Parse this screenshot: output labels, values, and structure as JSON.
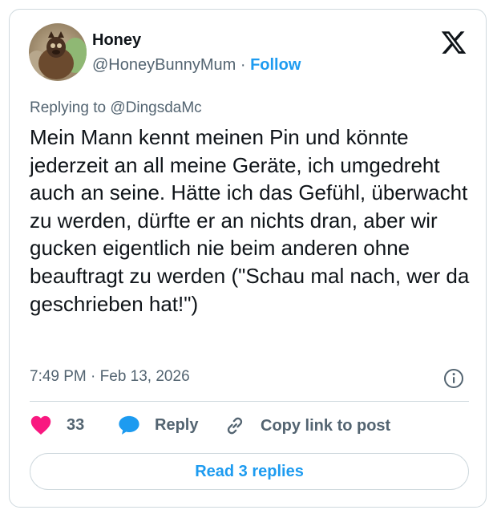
{
  "author": {
    "name": "Honey",
    "handle": "@HoneyBunnyMum",
    "separator": " · ",
    "follow_label": "Follow"
  },
  "reply_context": {
    "prefix": "Replying to ",
    "target": "@DingsdaMc"
  },
  "tweet": {
    "text": "Mein Mann kennt meinen Pin und könnte jederzeit an all meine Geräte, ich umgedreht auch an seine. Hätte ich das Gefühl, überwacht zu werden, dürfte er an nichts dran, aber wir gucken eigentlich nie beim anderen ohne beauftragt zu werden (\"Schau mal nach, wer da geschrieben hat!\")",
    "time": "7:49 PM",
    "date_separator": " · ",
    "date": "Feb 13, 2026"
  },
  "actions": {
    "like_count": "33",
    "reply_label": "Reply",
    "copy_label": "Copy link to post"
  },
  "read_replies_label": "Read 3 replies",
  "icons": {
    "logo": "x-logo-icon",
    "like": "heart-icon",
    "reply": "speech-bubble-icon",
    "copy": "link-icon",
    "info": "info-icon"
  },
  "colors": {
    "accent": "#1d9bf0",
    "like": "#f91880",
    "text": "#0f1419",
    "muted": "#536471",
    "border": "#cfd9de"
  }
}
